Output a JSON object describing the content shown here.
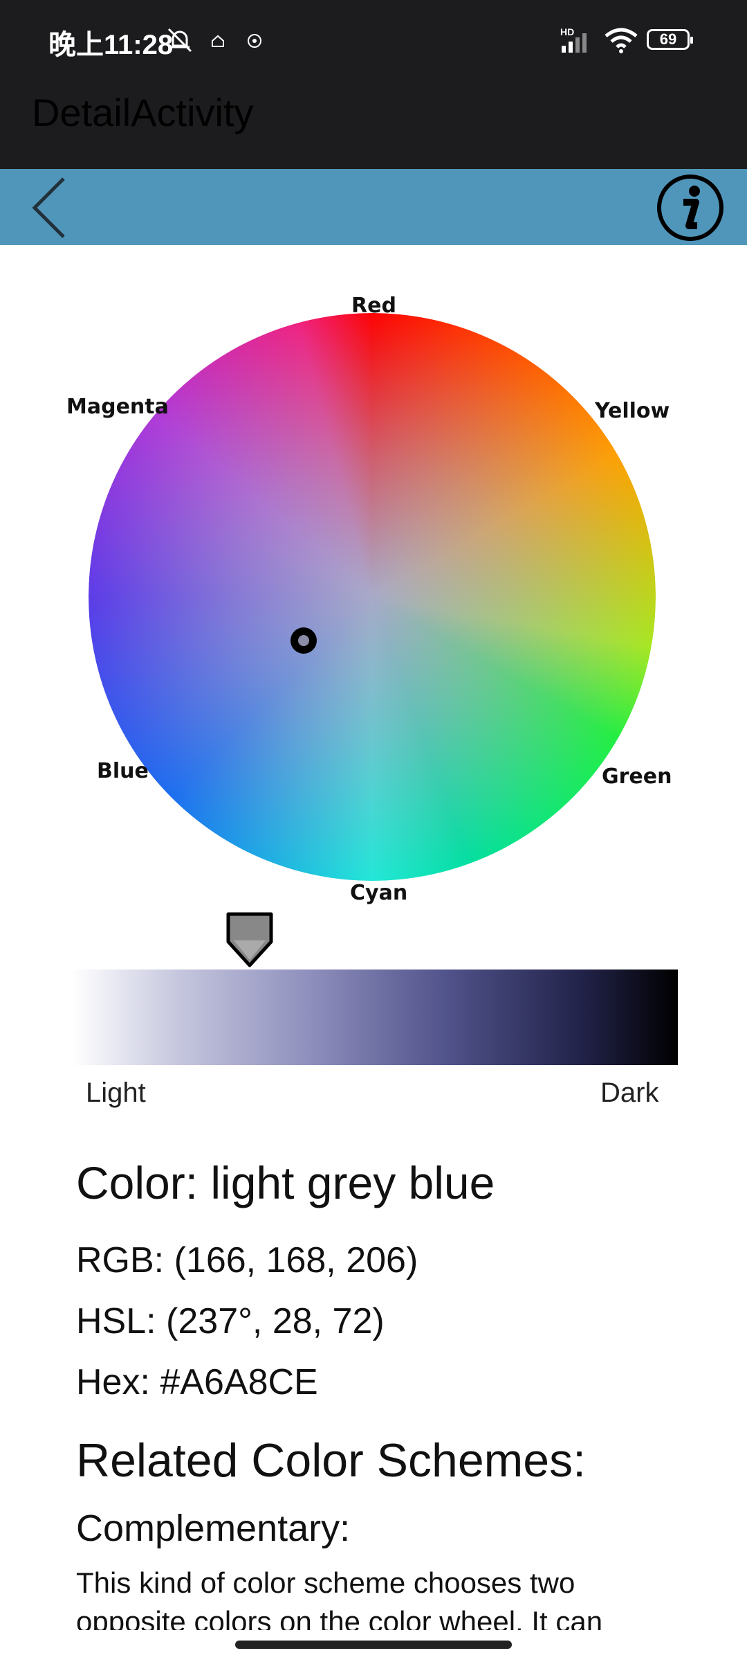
{
  "status_bar": {
    "time": "晚上11:28",
    "battery": "69",
    "network_badge": "HD",
    "icons": [
      "mute-bell-icon",
      "home-icon",
      "compass-icon",
      "signal-icon",
      "wifi-icon",
      "battery-icon"
    ]
  },
  "app_bar": {
    "title": "DetailActivity"
  },
  "toolbar": {
    "color": "#5096bb",
    "icons": [
      "back-chevron-icon",
      "info-icon"
    ]
  },
  "color_wheel": {
    "labels": {
      "red": "Red",
      "yellow": "Yellow",
      "green": "Green",
      "cyan": "Cyan",
      "blue": "Blue",
      "magenta": "Magenta"
    }
  },
  "lightness_slider": {
    "light_label": "Light",
    "dark_label": "Dark",
    "value": 0.29
  },
  "color_info": {
    "name": "Color: light grey blue",
    "rgb": "RGB: (166, 168, 206)",
    "hsl": "HSL: (237°, 28, 72)",
    "hex": "Hex: #A6A8CE",
    "swatch": "#A6A8CE"
  },
  "related": {
    "title": "Related Color Schemes:",
    "complementary_title": "Complementary:",
    "complementary_text": "This kind of color scheme chooses two opposite colors on the color wheel. It can"
  }
}
